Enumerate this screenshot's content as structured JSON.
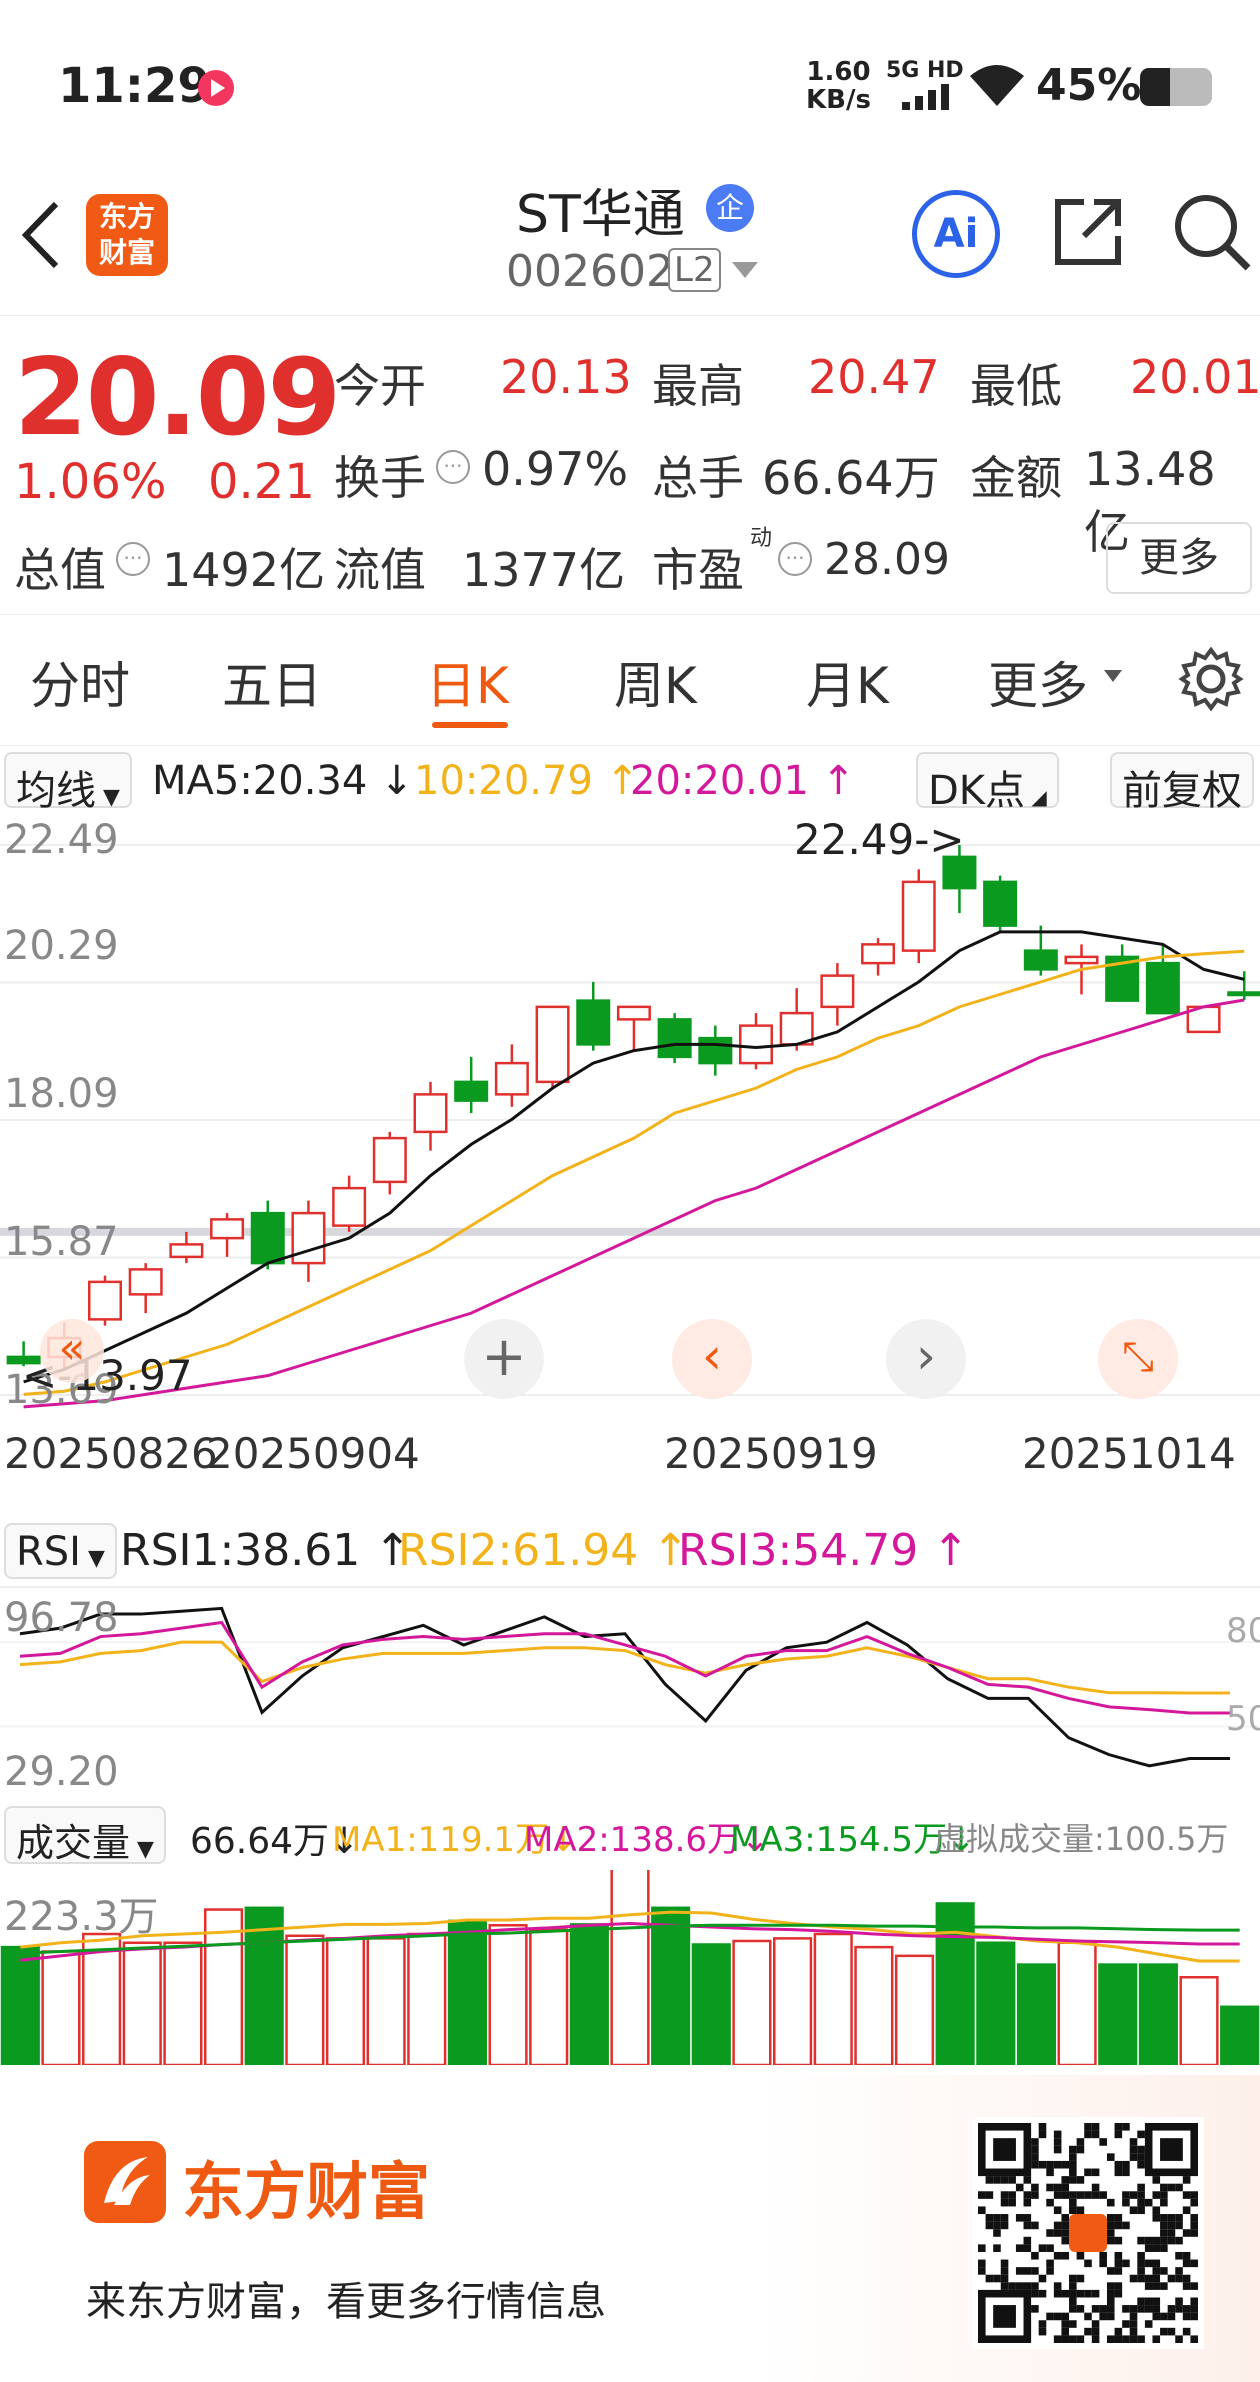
{
  "status_bar": {
    "time": "11:29",
    "net_speed": "1.60",
    "net_unit": "KB/s",
    "network": "5G HD",
    "battery": "45%"
  },
  "header": {
    "stock_name": "ST华通",
    "enterprise_badge": "企",
    "stock_code": "002602",
    "level_badge": "L2",
    "logo_line1": "东方",
    "logo_line2": "财富",
    "ai_label": "Ai"
  },
  "quote": {
    "price": "20.09",
    "change_pct": "1.06%",
    "change": "0.21",
    "open_label": "今开",
    "open": "20.13",
    "high_label": "最高",
    "high": "20.47",
    "low_label": "最低",
    "low": "20.01",
    "turnover_label": "换手",
    "turnover": "0.97%",
    "volume_label": "总手",
    "volume": "66.64万",
    "amount_label": "金额",
    "amount": "13.48亿",
    "mcap_label": "总值",
    "mcap": "1492亿",
    "float_label": "流值",
    "float_cap": "1377亿",
    "pe_label": "市盈",
    "pe_sup": "动",
    "pe": "28.09",
    "more_button": "更多"
  },
  "tabs": [
    {
      "label": "分时"
    },
    {
      "label": "五日"
    },
    {
      "label": "日K"
    },
    {
      "label": "周K"
    },
    {
      "label": "月K"
    },
    {
      "label": "更多"
    }
  ],
  "ma_legend": {
    "selector": "均线",
    "ma5": "MA5:20.34",
    "ma5_arrow": "↓",
    "ma10": "10:20.79",
    "ma10_arrow": "↑",
    "ma20": "20:20.01",
    "ma20_arrow": "↑",
    "dk_button": "DK点",
    "adjust_button": "前复权"
  },
  "kchart": {
    "axis_labels": [
      "22.49",
      "20.29",
      "18.09",
      "15.87",
      "13.69"
    ],
    "max_marker": "22.49->",
    "min_marker": "<-13.97",
    "dates": [
      "20250826",
      "20250904",
      "20250919",
      "20251014"
    ]
  },
  "rsi": {
    "selector": "RSI",
    "rsi1": "RSI1:38.61",
    "rsi1_arrow": "↑",
    "rsi2": "RSI2:61.94",
    "rsi2_arrow": "↑",
    "rsi3": "RSI3:54.79",
    "rsi3_arrow": "↑",
    "top_label": "96.78",
    "bottom_label": "29.20",
    "ref80": "80",
    "ref50": "50"
  },
  "volume": {
    "selector": "成交量",
    "value": "66.64万",
    "value_arrow": "↓",
    "ma1": "MA1:119.1万",
    "ma1_arrow": "↓",
    "ma2": "MA2:138.6万",
    "ma2_arrow": "↓",
    "ma3": "MA3:154.5万",
    "ma3_arrow": "↓",
    "virtual": "虚拟成交量:100.5万",
    "top_label": "223.3万"
  },
  "footer": {
    "brand": "东方财富",
    "slogan": "来东方财富，看更多行情信息"
  },
  "colors": {
    "up": "#e0302e",
    "down": "#0a9a1f",
    "ma5": "#111111",
    "ma10": "#f2b21a",
    "ma20": "#d4189c",
    "accent": "#ef5a12"
  },
  "chart_data": [
    {
      "type": "candlestick",
      "title": "日K",
      "ylim": [
        13.69,
        22.49
      ],
      "x": [
        "20250826",
        "20250827",
        "20250828",
        "20250829",
        "20250901",
        "20250902",
        "20250903",
        "20250904",
        "20250905",
        "20250908",
        "20250909",
        "20250910",
        "20250911",
        "20250912",
        "20250915",
        "20250916",
        "20250917",
        "20250918",
        "20250919",
        "20250922",
        "20250923",
        "20250924",
        "20250925",
        "20250926",
        "20250929",
        "20250930",
        "20251009",
        "20251010",
        "20251013",
        "20251014",
        "20251015"
      ],
      "series": [
        {
          "name": "日K",
          "ohlc": [
            [
              14.3,
              14.55,
              14.15,
              14.2
            ],
            [
              14.3,
              14.85,
              14.1,
              14.6
            ],
            [
              14.9,
              15.6,
              14.8,
              15.5
            ],
            [
              15.3,
              15.8,
              15.0,
              15.7
            ],
            [
              15.9,
              16.3,
              15.8,
              16.1
            ],
            [
              16.2,
              16.6,
              15.9,
              16.5
            ],
            [
              16.6,
              16.8,
              15.7,
              15.8
            ],
            [
              15.8,
              16.8,
              15.5,
              16.6
            ],
            [
              16.4,
              17.2,
              16.3,
              17.0
            ],
            [
              17.1,
              17.9,
              16.9,
              17.8
            ],
            [
              17.9,
              18.7,
              17.6,
              18.5
            ],
            [
              18.7,
              19.1,
              18.2,
              18.4
            ],
            [
              18.5,
              19.3,
              18.3,
              19.0
            ],
            [
              18.7,
              19.8,
              18.6,
              19.9
            ],
            [
              20.0,
              20.3,
              19.2,
              19.3
            ],
            [
              19.7,
              19.9,
              19.2,
              19.9
            ],
            [
              19.7,
              19.8,
              19.0,
              19.1
            ],
            [
              19.4,
              19.6,
              18.8,
              19.0
            ],
            [
              19.0,
              19.8,
              18.9,
              19.6
            ],
            [
              19.3,
              20.2,
              19.2,
              19.8
            ],
            [
              19.9,
              20.6,
              19.6,
              20.4
            ],
            [
              20.6,
              21.0,
              20.4,
              20.9
            ],
            [
              20.8,
              22.1,
              20.6,
              21.9
            ],
            [
              22.3,
              22.49,
              21.4,
              21.8
            ],
            [
              21.9,
              22.0,
              21.1,
              21.2
            ],
            [
              20.8,
              21.2,
              20.4,
              20.5
            ],
            [
              20.6,
              20.9,
              20.1,
              20.7
            ],
            [
              20.7,
              20.9,
              20.2,
              20.0
            ],
            [
              20.6,
              20.9,
              19.9,
              19.8
            ],
            [
              19.5,
              19.8,
              19.5,
              19.9
            ],
            [
              20.13,
              20.47,
              20.01,
              20.09
            ]
          ]
        },
        {
          "name": "MA5",
          "values": [
            13.9,
            14.1,
            14.4,
            14.7,
            15.0,
            15.4,
            15.8,
            16.0,
            16.2,
            16.6,
            17.2,
            17.7,
            18.1,
            18.6,
            19.0,
            19.2,
            19.3,
            19.3,
            19.25,
            19.3,
            19.5,
            19.9,
            20.3,
            20.8,
            21.1,
            21.1,
            21.1,
            21.0,
            20.9,
            20.5,
            20.34
          ]
        },
        {
          "name": "10",
          "values": [
            13.7,
            13.75,
            13.9,
            14.1,
            14.3,
            14.5,
            14.8,
            15.1,
            15.4,
            15.7,
            16.0,
            16.4,
            16.8,
            17.2,
            17.5,
            17.8,
            18.2,
            18.4,
            18.6,
            18.9,
            19.1,
            19.4,
            19.6,
            19.9,
            20.1,
            20.3,
            20.5,
            20.6,
            20.7,
            20.75,
            20.79
          ]
        },
        {
          "name": "20",
          "values": [
            13.5,
            13.55,
            13.6,
            13.7,
            13.8,
            13.9,
            14.0,
            14.2,
            14.4,
            14.6,
            14.8,
            15.0,
            15.3,
            15.6,
            15.9,
            16.2,
            16.5,
            16.8,
            17.0,
            17.3,
            17.6,
            17.9,
            18.2,
            18.5,
            18.8,
            19.1,
            19.3,
            19.5,
            19.7,
            19.9,
            20.01
          ]
        }
      ]
    },
    {
      "type": "line",
      "title": "RSI",
      "ylim": [
        29.2,
        96.78
      ],
      "x": [
        "1",
        "2",
        "3",
        "4",
        "5",
        "6",
        "7",
        "8",
        "9",
        "10",
        "11",
        "12",
        "13",
        "14",
        "15",
        "16",
        "17",
        "18",
        "19",
        "20",
        "21",
        "22",
        "23",
        "24",
        "25",
        "26",
        "27",
        "28",
        "29",
        "30",
        "31"
      ],
      "series": [
        {
          "name": "RSI1",
          "values": [
            83,
            85,
            90,
            90,
            91,
            92,
            55,
            68,
            78,
            82,
            86,
            79,
            84,
            89,
            82,
            83,
            65,
            52,
            70,
            78,
            80,
            87,
            79,
            67,
            60,
            60,
            46,
            40,
            36,
            38.61,
            38.61
          ]
        },
        {
          "name": "RSI2",
          "values": [
            72,
            73,
            76,
            77,
            80,
            80,
            66,
            71,
            74,
            76,
            76,
            76,
            77,
            78,
            78,
            77,
            72,
            69,
            72,
            74,
            75,
            78,
            75,
            71,
            67,
            67,
            64,
            62,
            62,
            61.94,
            61.94
          ]
        },
        {
          "name": "RSI3",
          "values": [
            75,
            76,
            82,
            83,
            85,
            87,
            64,
            73,
            79,
            81,
            82,
            81,
            82,
            83,
            83,
            79,
            75,
            68,
            75,
            77,
            77,
            82,
            76,
            71,
            65,
            64,
            60,
            57,
            56,
            54.79,
            54.79
          ]
        }
      ]
    },
    {
      "type": "bar",
      "title": "成交量",
      "ylim": [
        0,
        223.3
      ],
      "x": [
        "1",
        "2",
        "3",
        "4",
        "5",
        "6",
        "7",
        "8",
        "9",
        "10",
        "11",
        "12",
        "13",
        "14",
        "15",
        "16",
        "17",
        "18",
        "19",
        "20",
        "21",
        "22",
        "23",
        "24",
        "25",
        "26",
        "27",
        "28",
        "29",
        "30",
        "31"
      ],
      "series": [
        {
          "name": "成交量",
          "values": [
            135,
            130,
            150,
            140,
            140,
            178,
            180,
            148,
            145,
            145,
            150,
            165,
            160,
            155,
            161,
            225,
            180,
            138,
            142,
            145,
            150,
            135,
            125,
            185,
            140,
            115,
            140,
            115,
            115,
            100.5,
            66.64
          ]
        },
        {
          "name": "MA1",
          "values": [
            135,
            140,
            143,
            148,
            150,
            152,
            155,
            158,
            161,
            161,
            162,
            166,
            166,
            168,
            168,
            172,
            175,
            174,
            167,
            162,
            158,
            155,
            150,
            152,
            147,
            142,
            140,
            135,
            127,
            119.1,
            119.1
          ]
        },
        {
          "name": "MA2",
          "values": [
            120,
            125,
            130,
            133,
            135,
            138,
            140,
            143,
            145,
            148,
            150,
            152,
            155,
            157,
            160,
            162,
            160,
            158,
            156,
            155,
            153,
            150,
            148,
            147,
            146,
            144,
            142,
            141,
            140,
            138.6,
            138.6
          ]
        },
        {
          "name": "MA3",
          "values": [
            128,
            130,
            132,
            134,
            136,
            138,
            140,
            142,
            144,
            146,
            148,
            150,
            151,
            153,
            155,
            157,
            159,
            160,
            160,
            160,
            160,
            159,
            159,
            158,
            158,
            157,
            157,
            156,
            155,
            154.5,
            154.5
          ]
        }
      ]
    }
  ]
}
